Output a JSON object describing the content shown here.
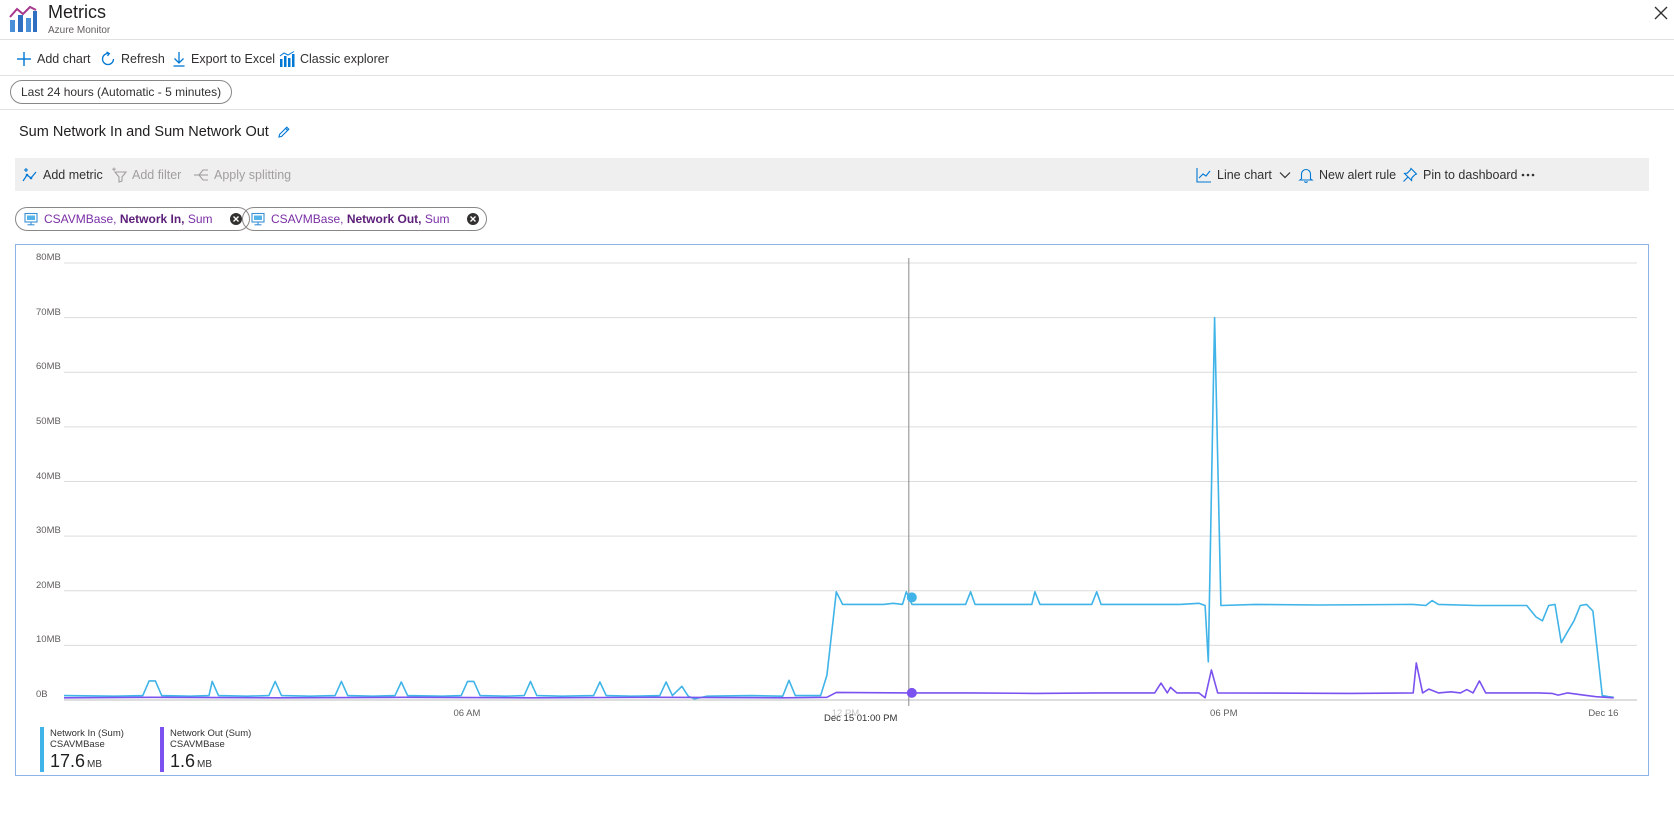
{
  "header": {
    "title": "Metrics",
    "subtitle": "Azure Monitor"
  },
  "commands": {
    "add_chart": "Add chart",
    "refresh": "Refresh",
    "export": "Export to Excel",
    "classic": "Classic explorer"
  },
  "time_range": "Last 24 hours (Automatic - 5 minutes)",
  "chart": {
    "title": "Sum Network In and Sum Network Out",
    "toolbar": {
      "add_metric": "Add metric",
      "add_filter": "Add filter",
      "apply_splitting": "Apply splitting",
      "chart_type": "Line chart",
      "new_alert": "New alert rule",
      "pin": "Pin to dashboard"
    },
    "pills": [
      {
        "resource": "CSAVMBase,",
        "metric": "Network In,",
        "aggregation": "Sum"
      },
      {
        "resource": "CSAVMBase,",
        "metric": "Network Out,",
        "aggregation": "Sum"
      }
    ],
    "crosshair_label": "Dec 15 01:00 PM",
    "legend": [
      {
        "name": "Network In (Sum)",
        "resource": "CSAVMBase",
        "value": "17.6",
        "unit": "MB",
        "color": "#40b4e8"
      },
      {
        "name": "Network Out (Sum)",
        "resource": "CSAVMBase",
        "value": "1.6",
        "unit": "MB",
        "color": "#7b52f0"
      }
    ]
  },
  "chart_data": {
    "type": "line",
    "y_ticks": [
      "80MB",
      "70MB",
      "60MB",
      "50MB",
      "40MB",
      "30MB",
      "20MB",
      "10MB",
      "0B"
    ],
    "ylim": [
      0,
      80
    ],
    "x_ticks": [
      {
        "label": "06 AM",
        "at_hour": 6
      },
      {
        "label": "12 PM",
        "at_hour": 12
      },
      {
        "label": "06 PM",
        "at_hour": 18
      },
      {
        "label": "Dec 16",
        "at_hour": 24
      }
    ],
    "xlim_hours": [
      -0.4,
      24.55
    ],
    "crosshair_hour": 13.0,
    "series": [
      {
        "name": "Network In (Sum)",
        "color": "#40b4e8",
        "points": [
          [
            -0.4,
            0.8
          ],
          [
            0.4,
            0.7
          ],
          [
            0.85,
            0.8
          ],
          [
            0.95,
            3.5
          ],
          [
            1.05,
            3.5
          ],
          [
            1.15,
            0.8
          ],
          [
            1.6,
            0.7
          ],
          [
            1.9,
            0.8
          ],
          [
            1.95,
            3.4
          ],
          [
            2.05,
            0.8
          ],
          [
            2.5,
            0.7
          ],
          [
            2.85,
            0.8
          ],
          [
            2.95,
            3.4
          ],
          [
            3.05,
            0.8
          ],
          [
            3.5,
            0.7
          ],
          [
            3.9,
            0.8
          ],
          [
            4.0,
            3.4
          ],
          [
            4.1,
            0.8
          ],
          [
            4.5,
            0.7
          ],
          [
            4.85,
            0.8
          ],
          [
            4.95,
            3.3
          ],
          [
            5.05,
            0.8
          ],
          [
            5.6,
            0.7
          ],
          [
            5.9,
            0.8
          ],
          [
            6.0,
            3.4
          ],
          [
            6.1,
            3.4
          ],
          [
            6.2,
            0.8
          ],
          [
            6.6,
            0.7
          ],
          [
            6.9,
            0.8
          ],
          [
            7.0,
            3.4
          ],
          [
            7.1,
            0.8
          ],
          [
            7.5,
            0.7
          ],
          [
            8.0,
            0.8
          ],
          [
            8.1,
            3.3
          ],
          [
            8.2,
            0.8
          ],
          [
            8.6,
            0.7
          ],
          [
            9.05,
            0.8
          ],
          [
            9.15,
            3.3
          ],
          [
            9.25,
            0.8
          ],
          [
            9.4,
            2.5
          ],
          [
            9.5,
            0.7
          ],
          [
            9.6,
            0.2
          ],
          [
            9.8,
            0.7
          ],
          [
            10.5,
            0.8
          ],
          [
            11.0,
            0.7
          ],
          [
            11.1,
            3.6
          ],
          [
            11.2,
            0.8
          ],
          [
            11.6,
            0.8
          ],
          [
            11.7,
            4.5
          ],
          [
            11.85,
            19.8
          ],
          [
            11.95,
            17.5
          ],
          [
            12.6,
            17.5
          ],
          [
            12.75,
            17.7
          ],
          [
            12.9,
            17.5
          ],
          [
            12.96,
            19.8
          ],
          [
            13.05,
            17.5
          ],
          [
            13.9,
            17.5
          ],
          [
            13.98,
            19.8
          ],
          [
            14.05,
            17.5
          ],
          [
            14.6,
            17.5
          ],
          [
            14.95,
            17.5
          ],
          [
            15.0,
            19.8
          ],
          [
            15.08,
            17.5
          ],
          [
            15.9,
            17.5
          ],
          [
            15.98,
            19.8
          ],
          [
            16.05,
            17.5
          ],
          [
            17.3,
            17.5
          ],
          [
            17.6,
            17.7
          ],
          [
            17.7,
            17.3
          ],
          [
            17.75,
            7.0
          ],
          [
            17.85,
            70.0
          ],
          [
            17.95,
            17.3
          ],
          [
            18.5,
            17.5
          ],
          [
            19.5,
            17.4
          ],
          [
            21.0,
            17.5
          ],
          [
            21.2,
            17.3
          ],
          [
            21.3,
            18.2
          ],
          [
            21.4,
            17.5
          ],
          [
            22.0,
            17.3
          ],
          [
            22.5,
            17.3
          ],
          [
            22.8,
            17.3
          ],
          [
            22.95,
            15.2
          ],
          [
            23.05,
            14.5
          ],
          [
            23.15,
            17.3
          ],
          [
            23.25,
            17.5
          ],
          [
            23.35,
            10.5
          ],
          [
            23.45,
            12.5
          ],
          [
            23.55,
            14.5
          ],
          [
            23.65,
            17.3
          ],
          [
            23.75,
            17.5
          ],
          [
            23.85,
            16.3
          ],
          [
            24.0,
            0.8
          ],
          [
            24.1,
            0.6
          ],
          [
            24.18,
            0.5
          ]
        ]
      },
      {
        "name": "Network Out (Sum)",
        "color": "#7b52f0",
        "points": [
          [
            -0.4,
            0.4
          ],
          [
            1.0,
            0.5
          ],
          [
            3.0,
            0.4
          ],
          [
            5.0,
            0.5
          ],
          [
            7.0,
            0.4
          ],
          [
            9.0,
            0.5
          ],
          [
            11.0,
            0.4
          ],
          [
            11.7,
            0.5
          ],
          [
            11.85,
            1.4
          ],
          [
            13.0,
            1.3
          ],
          [
            14.0,
            1.3
          ],
          [
            15.0,
            1.2
          ],
          [
            16.0,
            1.3
          ],
          [
            16.9,
            1.3
          ],
          [
            17.0,
            3.1
          ],
          [
            17.1,
            1.3
          ],
          [
            17.15,
            2.3
          ],
          [
            17.25,
            1.3
          ],
          [
            17.6,
            1.3
          ],
          [
            17.7,
            0.4
          ],
          [
            17.8,
            5.5
          ],
          [
            17.9,
            1.3
          ],
          [
            20.0,
            1.2
          ],
          [
            21.0,
            1.3
          ],
          [
            21.05,
            6.8
          ],
          [
            21.15,
            1.3
          ],
          [
            21.25,
            2.0
          ],
          [
            21.4,
            1.3
          ],
          [
            21.6,
            1.5
          ],
          [
            21.75,
            1.3
          ],
          [
            21.85,
            1.9
          ],
          [
            21.95,
            1.3
          ],
          [
            22.05,
            3.5
          ],
          [
            22.15,
            1.3
          ],
          [
            23.0,
            1.3
          ],
          [
            23.2,
            1.2
          ],
          [
            23.3,
            0.9
          ],
          [
            23.45,
            1.3
          ],
          [
            23.7,
            0.9
          ],
          [
            23.9,
            0.6
          ],
          [
            24.18,
            0.4
          ]
        ]
      }
    ]
  }
}
